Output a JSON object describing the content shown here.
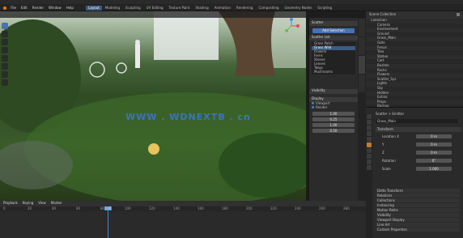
{
  "menu": [
    "File",
    "Edit",
    "Render",
    "Window",
    "Help"
  ],
  "workspace_tabs": [
    "Layout",
    "Modeling",
    "Sculpting",
    "UV Editing",
    "Texture Paint",
    "Shading",
    "Animation",
    "Rendering",
    "Compositing",
    "Geometry Nodes",
    "Scripting"
  ],
  "active_tab_index": 0,
  "watermark": "WWW . WDNEXTB . cn",
  "npanel": {
    "section1": "Scatter",
    "btn_label": "Add Selection",
    "section2": "Scatter List",
    "list_items": [
      "Grass Patch",
      "Grass Wild",
      "Flowers",
      "Ferns",
      "Stones",
      "Leaves",
      "Twigs",
      "Mushrooms"
    ],
    "section3": "Visibility",
    "section4": "Display",
    "checkbox1": "Viewport",
    "checkbox2": "Render",
    "values": [
      "1.00",
      "0.25",
      "1.00",
      "0.50"
    ]
  },
  "outliner": {
    "title": "Scene Collection",
    "rows": [
      "Collection",
      "Camera",
      "Environment",
      "Ground",
      "Grass_Main",
      "Gate",
      "Fence",
      "Tree",
      "Statue",
      "Cart",
      "Bushes",
      "Rocks",
      "Flowers",
      "Scatter_Sys",
      "Lights",
      "Sky",
      "Hidden",
      "Extras",
      "Props",
      "Backup"
    ]
  },
  "properties": {
    "obj_title": "Grass_Main",
    "breadcrumb": "Scatter > Emitter",
    "section": "Transform",
    "field_labels": [
      "Location X",
      "Y",
      "Z",
      "Rotation",
      "Scale"
    ],
    "field_values": [
      "0 m",
      "0 m",
      "0 m",
      "0°",
      "1.000"
    ],
    "bottom_sections": [
      "Delta Transform",
      "Relations",
      "Collections",
      "Instancing",
      "Motion Paths",
      "Visibility",
      "Viewport Display",
      "Line Art",
      "Custom Properties"
    ]
  },
  "timeline": {
    "menus": [
      "Playback",
      "Keying",
      "View",
      "Marker"
    ],
    "frame_current": "100",
    "ruler": [
      "0",
      "20",
      "40",
      "60",
      "80",
      "100",
      "120",
      "140",
      "160",
      "180",
      "200",
      "220",
      "240",
      "260",
      "280"
    ]
  }
}
